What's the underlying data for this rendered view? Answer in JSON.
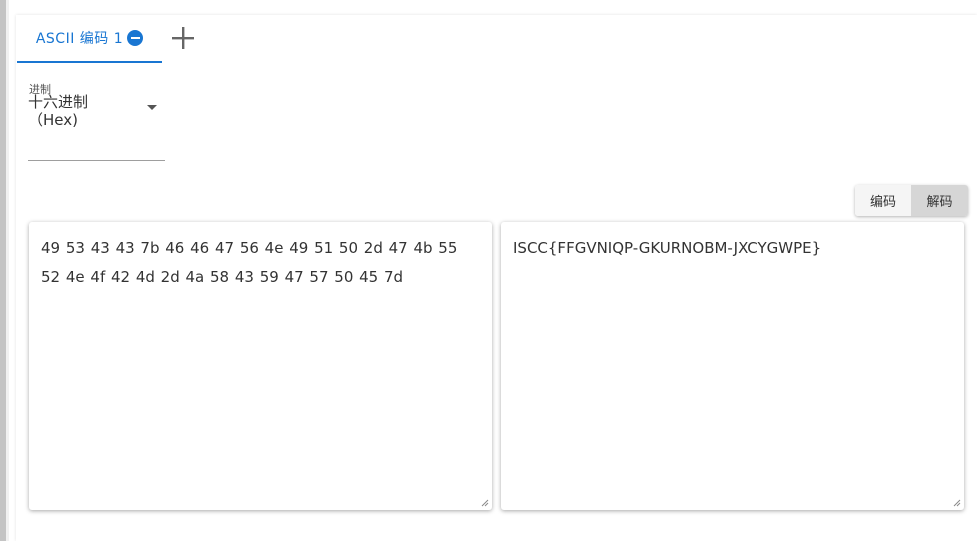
{
  "tabs": [
    {
      "label": "ASCII 编码 1"
    }
  ],
  "base_select": {
    "label": "进制",
    "value": "十六进制（Hex)"
  },
  "mode_toggle": {
    "encode_label": "编码",
    "decode_label": "解码",
    "selected": "解码"
  },
  "input_text": "49 53 43 43 7b 46 46 47 56 4e 49 51 50 2d 47 4b 55 52 4e 4f 42 4d 2d 4a 58 43 59 47 57 50 45 7d",
  "output_text": "ISCC{FFGVNIQP-GKURNOBM-JXCYGWPE}",
  "colors": {
    "accent": "#1976d2",
    "selected_button_bg": "#d6d6d6"
  },
  "icons": {
    "tab_close": "minus-circle-icon",
    "add_tab": "plus-icon",
    "select_arrow": "caret-down-icon",
    "resize": "resize-grip-icon"
  }
}
